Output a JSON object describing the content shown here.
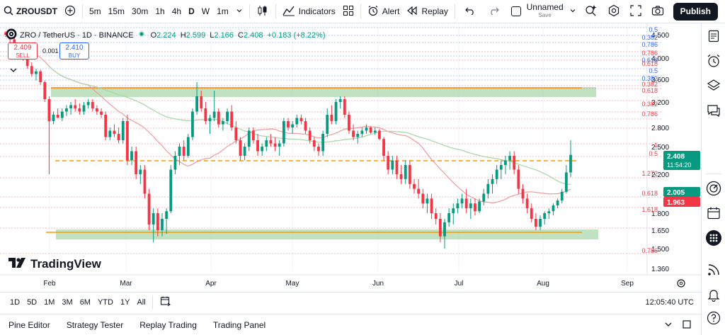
{
  "toolbar": {
    "symbol": "ZROUSDT",
    "timeframes": [
      "5m",
      "15m",
      "30m",
      "1h",
      "4h",
      "D",
      "W",
      "1m"
    ],
    "indicators_label": "Indicators",
    "alert_label": "Alert",
    "replay_label": "Replay",
    "layout_name": "Unnamed",
    "layout_status": "Save",
    "publish_label": "Publish"
  },
  "legend": {
    "pair": "ZRO / TetherUS · 1D · BINANCE",
    "o_label": "O",
    "o": "2.224",
    "h_label": "H",
    "h": "2.599",
    "l_label": "L",
    "l": "2.166",
    "c_label": "C",
    "c": "2.408",
    "change": "+0.183 (+8.22%)"
  },
  "trade": {
    "sell_price": "2.409",
    "sell_label": "SELL",
    "spread": "0.001",
    "buy_price": "2.410",
    "buy_label": "BUY"
  },
  "branding": "TradingView",
  "colors": {
    "up": "#089981",
    "down": "#f23645",
    "accent": "#2962ff",
    "zone": "#a5d6a7",
    "level": "#ff9800"
  },
  "chart_data": {
    "type": "candlestick",
    "x_ticks": [
      "Feb",
      "Mar",
      "Apr",
      "May",
      "Jun",
      "Jul",
      "Aug",
      "Sep"
    ],
    "y_ticks": [
      "4.500",
      "4.000",
      "3.600",
      "3.200",
      "2.800",
      "2.500",
      "2.200",
      "1.800",
      "1.650",
      "1.500",
      "1.360"
    ],
    "ylim": [
      1.3,
      4.7
    ],
    "price_labels": [
      {
        "text": "2.408",
        "sub": "11:54:20",
        "color": "#089981"
      },
      {
        "text": "2.005",
        "sub": "",
        "color": "#089981"
      },
      {
        "text": "1.963",
        "sub": "",
        "color": "#f23645"
      }
    ],
    "fib_labels": [
      {
        "text": "0.5",
        "color": "#2962ff"
      },
      {
        "text": "0.382",
        "color": "#2962ff"
      },
      {
        "text": "0.786",
        "color": "#2962ff"
      },
      {
        "text": "0.786",
        "color": "#f23645"
      },
      {
        "text": "0.618",
        "color": "#2962ff"
      },
      {
        "text": "0.618",
        "color": "#f23645"
      },
      {
        "text": "0.5",
        "color": "#2962ff"
      },
      {
        "text": "0.382",
        "color": "#2962ff"
      },
      {
        "text": "0.382",
        "color": "#f23645"
      },
      {
        "text": "0.618",
        "color": "#f23645"
      },
      {
        "text": "0.382",
        "color": "#f23645"
      },
      {
        "text": "0.786",
        "color": "#f23645"
      },
      {
        "text": "1",
        "color": "#f23645"
      },
      {
        "text": "0.5",
        "color": "#f23645"
      },
      {
        "text": "1.272",
        "color": "#f23645"
      },
      {
        "text": "0.618",
        "color": "#f23645"
      },
      {
        "text": "1.618",
        "color": "#f23645"
      },
      {
        "text": "0.786",
        "color": "#f23645"
      }
    ],
    "levels": {
      "resistance_zone": [
        3.3,
        3.4
      ],
      "support_zone": [
        1.6,
        1.66
      ],
      "dashed_level": 2.38
    },
    "candles": [
      [
        4.55,
        4.58,
        4.45,
        4.5
      ],
      [
        4.5,
        4.52,
        4.33,
        4.4
      ],
      [
        4.4,
        4.44,
        4.2,
        4.25
      ],
      [
        4.25,
        4.3,
        4.08,
        4.12
      ],
      [
        4.12,
        4.15,
        3.95,
        4.0
      ],
      [
        4.0,
        4.05,
        3.8,
        3.85
      ],
      [
        3.85,
        3.92,
        3.65,
        3.7
      ],
      [
        3.7,
        3.8,
        3.58,
        3.75
      ],
      [
        3.75,
        3.78,
        3.5,
        3.55
      ],
      [
        3.55,
        3.58,
        3.2,
        3.25
      ],
      [
        3.25,
        3.3,
        2.2,
        2.9
      ],
      [
        2.9,
        3.05,
        2.85,
        3.0
      ],
      [
        3.0,
        3.1,
        2.95,
        2.95
      ],
      [
        2.95,
        3.1,
        2.9,
        3.05
      ],
      [
        3.05,
        3.15,
        2.98,
        3.1
      ],
      [
        3.1,
        3.2,
        3.0,
        3.15
      ],
      [
        3.15,
        3.25,
        3.05,
        3.1
      ],
      [
        3.1,
        3.18,
        3.0,
        3.05
      ],
      [
        3.05,
        3.2,
        3.0,
        3.15
      ],
      [
        3.15,
        3.25,
        3.1,
        3.2
      ],
      [
        3.2,
        3.25,
        3.05,
        3.1
      ],
      [
        3.1,
        3.15,
        3.0,
        3.05
      ],
      [
        3.05,
        3.1,
        2.95,
        3.0
      ],
      [
        3.0,
        3.05,
        2.6,
        2.65
      ],
      [
        2.65,
        2.8,
        2.6,
        2.75
      ],
      [
        2.75,
        2.85,
        2.65,
        2.7
      ],
      [
        2.7,
        2.8,
        2.55,
        2.6
      ],
      [
        2.6,
        2.95,
        2.55,
        2.9
      ],
      [
        2.9,
        3.0,
        2.3,
        2.35
      ],
      [
        2.35,
        2.5,
        2.3,
        2.45
      ],
      [
        2.45,
        2.5,
        2.15,
        2.2
      ],
      [
        2.2,
        2.3,
        2.1,
        2.25
      ],
      [
        2.25,
        2.3,
        1.95,
        2.0
      ],
      [
        2.0,
        2.05,
        1.65,
        1.7
      ],
      [
        1.7,
        1.85,
        1.55,
        1.8
      ],
      [
        1.8,
        1.85,
        1.6,
        1.65
      ],
      [
        1.65,
        1.8,
        1.6,
        1.75
      ],
      [
        1.75,
        1.85,
        1.62,
        1.82
      ],
      [
        1.82,
        2.3,
        1.8,
        2.25
      ],
      [
        2.25,
        2.45,
        2.2,
        2.4
      ],
      [
        2.4,
        2.55,
        2.3,
        2.5
      ],
      [
        2.5,
        2.6,
        2.35,
        2.4
      ],
      [
        2.4,
        2.7,
        2.38,
        2.65
      ],
      [
        2.65,
        3.1,
        2.6,
        3.05
      ],
      [
        3.05,
        3.55,
        3.0,
        3.3
      ],
      [
        3.3,
        3.4,
        3.05,
        3.1
      ],
      [
        3.1,
        3.2,
        2.85,
        2.9
      ],
      [
        2.9,
        3.0,
        2.7,
        2.95
      ],
      [
        2.95,
        3.4,
        2.9,
        3.05
      ],
      [
        3.05,
        3.1,
        2.8,
        2.85
      ],
      [
        2.85,
        2.95,
        2.75,
        2.9
      ],
      [
        2.9,
        3.1,
        2.85,
        3.05
      ],
      [
        3.05,
        3.15,
        2.75,
        2.8
      ],
      [
        2.8,
        2.9,
        2.55,
        2.6
      ],
      [
        2.6,
        2.65,
        2.35,
        2.4
      ],
      [
        2.4,
        2.55,
        2.35,
        2.5
      ],
      [
        2.5,
        2.8,
        2.45,
        2.75
      ],
      [
        2.75,
        2.8,
        2.55,
        2.6
      ],
      [
        2.6,
        2.7,
        2.4,
        2.45
      ],
      [
        2.45,
        2.55,
        2.4,
        2.5
      ],
      [
        2.5,
        2.65,
        2.45,
        2.6
      ],
      [
        2.6,
        2.7,
        2.5,
        2.55
      ],
      [
        2.55,
        2.65,
        2.45,
        2.5
      ],
      [
        2.5,
        2.6,
        2.4,
        2.55
      ],
      [
        2.55,
        2.95,
        2.5,
        2.9
      ],
      [
        2.9,
        2.95,
        2.75,
        2.8
      ],
      [
        2.8,
        2.9,
        2.7,
        2.85
      ],
      [
        2.85,
        3.0,
        2.8,
        2.95
      ],
      [
        2.95,
        3.0,
        2.85,
        2.9
      ],
      [
        2.9,
        2.95,
        2.7,
        2.75
      ],
      [
        2.75,
        2.8,
        2.55,
        2.6
      ],
      [
        2.6,
        2.65,
        2.45,
        2.5
      ],
      [
        2.5,
        2.55,
        2.4,
        2.45
      ],
      [
        2.45,
        2.75,
        2.4,
        2.7
      ],
      [
        2.7,
        3.1,
        2.65,
        3.0
      ],
      [
        3.0,
        3.15,
        2.85,
        2.9
      ],
      [
        2.9,
        3.25,
        2.85,
        3.2
      ],
      [
        3.2,
        3.3,
        3.1,
        3.25
      ],
      [
        3.25,
        3.3,
        2.95,
        3.0
      ],
      [
        3.0,
        3.05,
        2.7,
        2.75
      ],
      [
        2.75,
        2.85,
        2.6,
        2.65
      ],
      [
        2.65,
        2.75,
        2.55,
        2.7
      ],
      [
        2.7,
        2.8,
        2.65,
        2.75
      ],
      [
        2.75,
        2.85,
        2.7,
        2.8
      ],
      [
        2.8,
        2.82,
        2.7,
        2.72
      ],
      [
        2.72,
        2.8,
        2.68,
        2.75
      ],
      [
        2.75,
        2.78,
        2.6,
        2.62
      ],
      [
        2.62,
        2.65,
        2.35,
        2.4
      ],
      [
        2.4,
        2.45,
        2.2,
        2.25
      ],
      [
        2.25,
        2.4,
        2.2,
        2.35
      ],
      [
        2.35,
        2.4,
        2.15,
        2.2
      ],
      [
        2.2,
        2.3,
        2.1,
        2.15
      ],
      [
        2.15,
        2.35,
        2.1,
        2.3
      ],
      [
        2.3,
        2.35,
        2.05,
        2.1
      ],
      [
        2.1,
        2.15,
        2.0,
        2.05
      ],
      [
        2.05,
        2.15,
        1.95,
        2.0
      ],
      [
        2.0,
        2.05,
        1.85,
        1.9
      ],
      [
        1.9,
        2.0,
        1.8,
        1.95
      ],
      [
        1.95,
        2.0,
        1.75,
        1.8
      ],
      [
        1.8,
        1.85,
        1.7,
        1.75
      ],
      [
        1.75,
        1.8,
        1.55,
        1.6
      ],
      [
        1.6,
        1.75,
        1.5,
        1.72
      ],
      [
        1.72,
        1.85,
        1.68,
        1.8
      ],
      [
        1.8,
        1.9,
        1.7,
        1.85
      ],
      [
        1.85,
        1.95,
        1.8,
        1.9
      ],
      [
        1.9,
        2.0,
        1.85,
        1.95
      ],
      [
        1.95,
        2.05,
        1.8,
        1.85
      ],
      [
        1.85,
        1.95,
        1.75,
        1.9
      ],
      [
        1.9,
        1.95,
        1.78,
        1.82
      ],
      [
        1.82,
        1.95,
        1.8,
        1.92
      ],
      [
        1.92,
        2.05,
        1.88,
        2.0
      ],
      [
        2.0,
        2.15,
        1.95,
        2.1
      ],
      [
        2.1,
        2.2,
        2.0,
        2.15
      ],
      [
        2.15,
        2.3,
        2.1,
        2.25
      ],
      [
        2.25,
        2.35,
        2.15,
        2.3
      ],
      [
        2.3,
        2.4,
        2.2,
        2.35
      ],
      [
        2.35,
        2.45,
        2.25,
        2.4
      ],
      [
        2.4,
        2.45,
        2.2,
        2.25
      ],
      [
        2.25,
        2.3,
        2.0,
        2.05
      ],
      [
        2.05,
        2.1,
        1.9,
        1.95
      ],
      [
        1.95,
        2.0,
        1.8,
        1.85
      ],
      [
        1.85,
        1.9,
        1.72,
        1.75
      ],
      [
        1.75,
        1.8,
        1.65,
        1.68
      ],
      [
        1.68,
        1.78,
        1.65,
        1.75
      ],
      [
        1.75,
        1.82,
        1.7,
        1.8
      ],
      [
        1.8,
        1.85,
        1.75,
        1.82
      ],
      [
        1.82,
        1.9,
        1.78,
        1.88
      ],
      [
        1.88,
        1.95,
        1.85,
        1.93
      ],
      [
        1.93,
        2.05,
        1.9,
        2.02
      ],
      [
        2.02,
        2.3,
        2.0,
        2.22
      ],
      [
        2.22,
        2.6,
        2.17,
        2.41
      ]
    ]
  },
  "rangebar": {
    "ranges": [
      "1D",
      "5D",
      "1M",
      "3M",
      "6M",
      "YTD",
      "1Y",
      "All"
    ],
    "clock": "12:05:40 UTC"
  },
  "panels": [
    "Pine Editor",
    "Strategy Tester",
    "Replay Trading",
    "Trading Panel"
  ]
}
